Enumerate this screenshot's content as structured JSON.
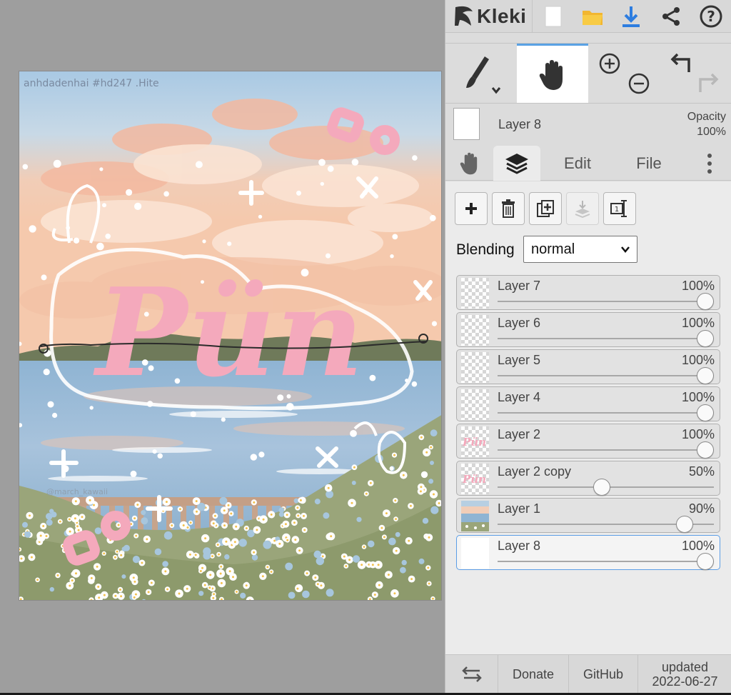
{
  "app": {
    "logo_text": "Kleki",
    "accent_color": "#5aa1e3"
  },
  "artwork": {
    "watermark_top": "anhdadenhai #hd247 .Hite",
    "watermark_bottom": "@march_kawaii",
    "title_lettering": "Pün",
    "title_color": "#f4a9bc"
  },
  "topbar": {
    "icons": [
      "new-image-icon",
      "open-folder-icon",
      "download-icon",
      "share-icon",
      "help-icon"
    ]
  },
  "tools": {
    "brush": "brush-icon",
    "hand": "hand-icon",
    "zoom_in": "zoom-in-icon",
    "zoom_out": "zoom-out-icon",
    "undo": "undo-icon",
    "redo": "redo-icon"
  },
  "current_layer": {
    "name": "Layer 8",
    "opacity_label": "Opacity",
    "opacity_value": "100%",
    "color": "#ffffff"
  },
  "tabs": [
    {
      "icon": "hand-icon",
      "label": ""
    },
    {
      "icon": "layers-icon",
      "label": ""
    },
    {
      "icon": "",
      "label": "Edit"
    },
    {
      "icon": "",
      "label": "File"
    },
    {
      "icon": "more-vertical-icon",
      "label": ""
    }
  ],
  "layer_actions": [
    "add-layer-icon",
    "delete-layer-icon",
    "duplicate-layer-icon",
    "merge-down-icon",
    "rename-layer-icon"
  ],
  "blending": {
    "label": "Blending",
    "value": "normal"
  },
  "layers": [
    {
      "name": "Layer 7",
      "opacity": "100%",
      "opacity_value": 1.0,
      "thumb": "transparent",
      "selected": false
    },
    {
      "name": "Layer 6",
      "opacity": "100%",
      "opacity_value": 1.0,
      "thumb": "transparent",
      "selected": false
    },
    {
      "name": "Layer 5",
      "opacity": "100%",
      "opacity_value": 1.0,
      "thumb": "transparent",
      "selected": false
    },
    {
      "name": "Layer 4",
      "opacity": "100%",
      "opacity_value": 1.0,
      "thumb": "transparent",
      "selected": false
    },
    {
      "name": "Layer 2",
      "opacity": "100%",
      "opacity_value": 1.0,
      "thumb": "pink-text",
      "selected": false
    },
    {
      "name": "Layer 2 copy",
      "opacity": "50%",
      "opacity_value": 0.5,
      "thumb": "pink-text",
      "selected": false
    },
    {
      "name": "Layer 1",
      "opacity": "90%",
      "opacity_value": 0.9,
      "thumb": "landscape",
      "selected": false
    },
    {
      "name": "Layer 8",
      "opacity": "100%",
      "opacity_value": 1.0,
      "thumb": "white",
      "selected": true
    }
  ],
  "bottombar": {
    "swap_icon": "swap-arrows-icon",
    "donate": "Donate",
    "github": "GitHub",
    "updated_label": "updated",
    "updated_date": "2022-06-27"
  }
}
